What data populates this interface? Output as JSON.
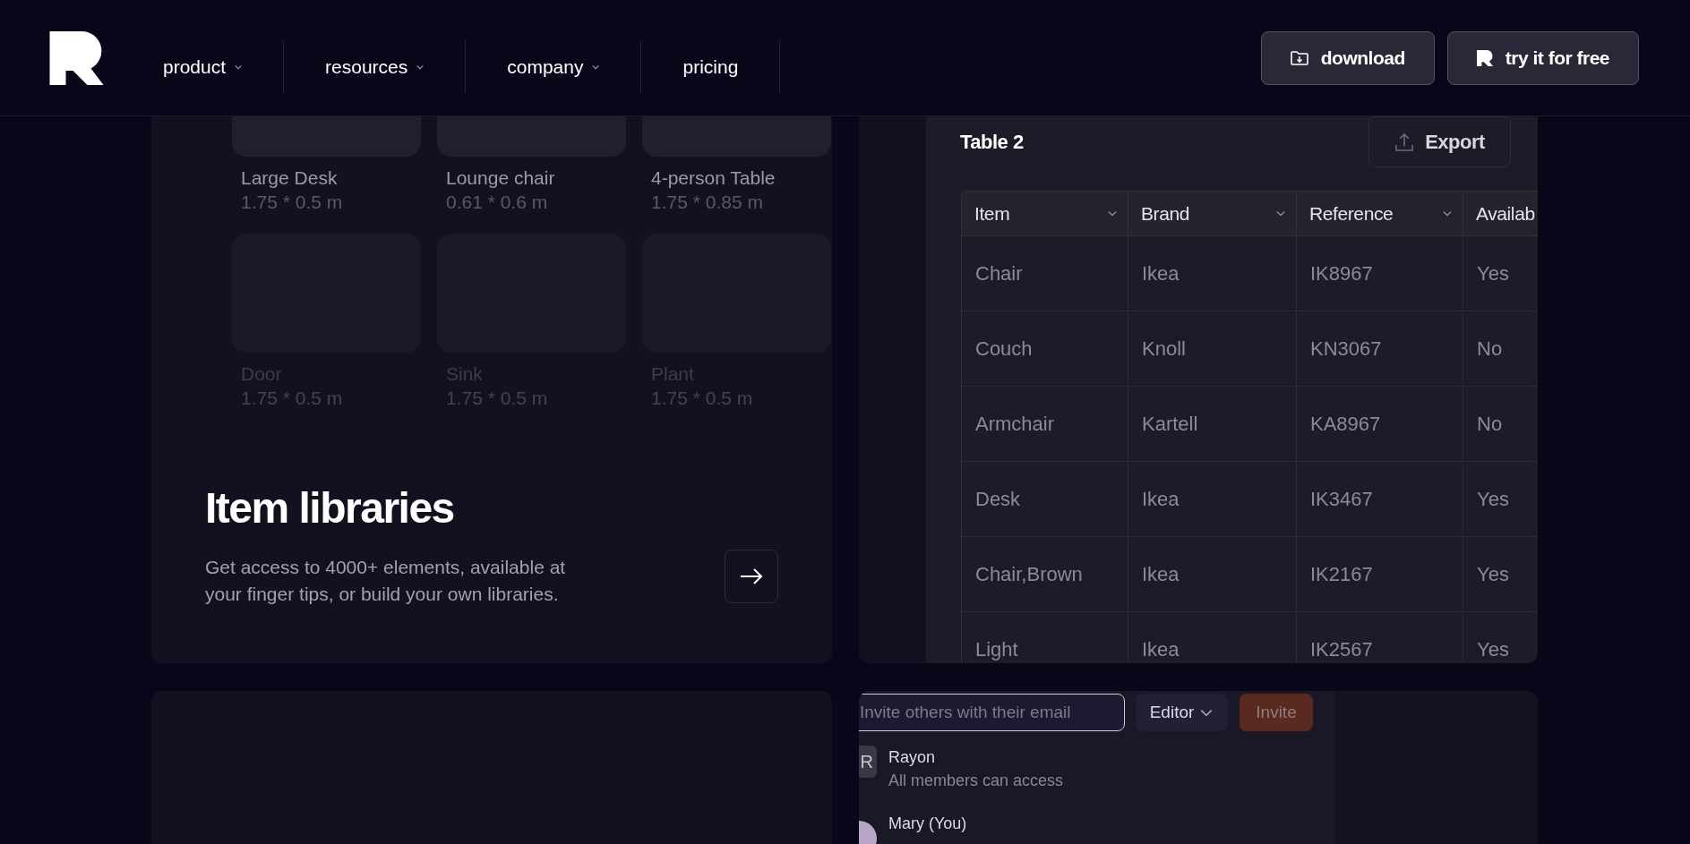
{
  "nav": {
    "items": [
      {
        "label": "product",
        "has_menu": true
      },
      {
        "label": "resources",
        "has_menu": true
      },
      {
        "label": "company",
        "has_menu": true
      },
      {
        "label": "pricing",
        "has_menu": false
      }
    ],
    "buttons": [
      {
        "label": "download",
        "kind": "download"
      },
      {
        "label": "try it for free",
        "kind": "logo"
      }
    ]
  },
  "library_card": {
    "items": [
      {
        "name": "Large Desk",
        "size": "1.75 * 0.5 m",
        "dimmed": false
      },
      {
        "name": "Lounge chair",
        "size": "0.61 * 0.6 m",
        "dimmed": false
      },
      {
        "name": "4-person Table",
        "size": "1.75 * 0.85 m",
        "dimmed": false
      },
      {
        "name": "Door",
        "size": "1.75 * 0.5 m",
        "dimmed": true
      },
      {
        "name": "Sink",
        "size": "1.75 * 0.5 m",
        "dimmed": true
      },
      {
        "name": "Plant",
        "size": "1.75 * 0.5 m",
        "dimmed": true
      }
    ],
    "title": "Item libraries",
    "description": "Get access to 4000+ elements, available at your finger tips, or build your own libraries."
  },
  "table_card": {
    "title": "Table 2",
    "export": "Export",
    "columns": [
      {
        "label": "Item",
        "sortable": true
      },
      {
        "label": "Brand",
        "sortable": true
      },
      {
        "label": "Reference",
        "sortable": true
      },
      {
        "label": "Availab"
      }
    ],
    "rows": [
      [
        "Chair",
        "Ikea",
        "IK8967",
        "Yes"
      ],
      [
        "Couch",
        "Knoll",
        "KN3067",
        "No"
      ],
      [
        "Armchair",
        "Kartell",
        "KA8967",
        "No"
      ],
      [
        "Desk",
        "Ikea",
        "IK3467",
        "Yes"
      ],
      [
        "Chair,Brown",
        "Ikea",
        "IK2167",
        "Yes"
      ],
      [
        "Light",
        "Ikea",
        "IK2567",
        "Yes"
      ]
    ]
  },
  "invite_panel": {
    "placeholder": "Invite others with their email",
    "role": "Editor",
    "button": "Invite",
    "members": [
      {
        "kind": "square",
        "initial": "R",
        "name": "Rayon",
        "detail": "All members can access"
      },
      {
        "kind": "circle",
        "name": "Mary (You)"
      }
    ]
  }
}
